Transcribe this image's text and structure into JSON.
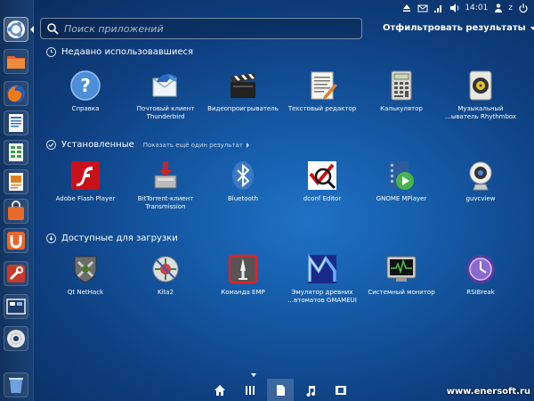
{
  "launcher": {
    "items": [
      {
        "name": "dash-home-button",
        "icon": "ubuntu-logo-icon",
        "active": true
      },
      {
        "name": "files-button",
        "icon": "folder-icon"
      },
      {
        "name": "firefox-button",
        "icon": "firefox-icon"
      },
      {
        "name": "writer-button",
        "icon": "writer-icon"
      },
      {
        "name": "calc-button",
        "icon": "spreadsheet-icon"
      },
      {
        "name": "impress-button",
        "icon": "presentation-icon"
      },
      {
        "name": "software-center-button",
        "icon": "bag-icon"
      },
      {
        "name": "ubuntu-one-button",
        "icon": "ubuntu-one-icon"
      },
      {
        "name": "settings-button",
        "icon": "tools-icon"
      },
      {
        "name": "workspaces-button",
        "icon": "workspace-icon"
      },
      {
        "name": "disc-button",
        "icon": "cd-icon"
      },
      {
        "name": "trash-button",
        "icon": "trash-icon"
      }
    ]
  },
  "topbar": {
    "time": "14:01",
    "user": "z"
  },
  "search": {
    "placeholder": "Поиск приложений"
  },
  "filter": {
    "label": "Отфильтровать результаты"
  },
  "sections": {
    "recent": {
      "title": "Недавно использовавшиеся",
      "apps": [
        {
          "label": "Справка",
          "icon": "help-icon"
        },
        {
          "label": "Почтовый клиент\nThunderbird",
          "icon": "thunderbird-icon"
        },
        {
          "label": "Видеопроигрыватель",
          "icon": "video-player-icon"
        },
        {
          "label": "Текстовый редактор",
          "icon": "text-editor-icon"
        },
        {
          "label": "Калькулятор",
          "icon": "calculator-icon"
        },
        {
          "label": "Музыкальный\n…ыватель Rhythmbox",
          "icon": "rhythmbox-icon"
        }
      ]
    },
    "installed": {
      "title": "Установленные",
      "more": "Показать ещё один результат",
      "apps": [
        {
          "label": "Adobe Flash Player",
          "icon": "flash-icon"
        },
        {
          "label": "BitTorrent-клиент\nTransmission",
          "icon": "transmission-icon"
        },
        {
          "label": "Bluetooth",
          "icon": "bluetooth-icon"
        },
        {
          "label": "dconf Editor",
          "icon": "dconf-icon"
        },
        {
          "label": "GNOME MPlayer",
          "icon": "mplayer-icon"
        },
        {
          "label": "guvcview",
          "icon": "webcam-icon"
        }
      ]
    },
    "available": {
      "title": "Доступные для загрузки",
      "apps": [
        {
          "label": "Qt NetHack",
          "icon": "nethack-icon"
        },
        {
          "label": "Kita2",
          "icon": "kita-icon"
        },
        {
          "label": "Команда EMP",
          "icon": "emp-icon"
        },
        {
          "label": "Эмулятор древних\n…втоматов GMAMEUI",
          "icon": "gmameui-icon"
        },
        {
          "label": "Системный монитор",
          "icon": "system-monitor-icon"
        },
        {
          "label": "RSIBreak",
          "icon": "rsibreak-icon"
        }
      ]
    }
  },
  "lenses": [
    {
      "name": "home-lens",
      "icon": "home-icon"
    },
    {
      "name": "applications-lens",
      "icon": "apps-icon",
      "active": true
    },
    {
      "name": "files-lens",
      "icon": "file-icon"
    },
    {
      "name": "music-lens",
      "icon": "music-icon"
    },
    {
      "name": "video-lens",
      "icon": "film-icon"
    }
  ],
  "watermark": "www.enersoft.ru"
}
